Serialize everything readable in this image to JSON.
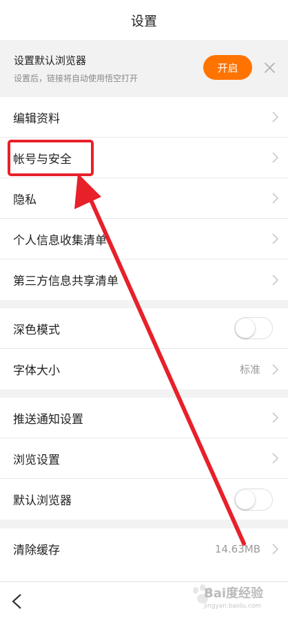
{
  "header": {
    "title": "设置"
  },
  "banner": {
    "title": "设置默认浏览器",
    "subtitle": "设置后，链接将自动使用悟空打开",
    "button_label": "开启",
    "close_icon": "close-icon"
  },
  "section_1": {
    "rows": [
      {
        "label": "编辑资料"
      },
      {
        "label": "帐号与安全"
      },
      {
        "label": "隐私"
      },
      {
        "label": "个人信息收集清单"
      },
      {
        "label": "第三方信息共享清单"
      }
    ]
  },
  "section_2": {
    "rows": [
      {
        "label": "深色模式",
        "toggle_on": false
      },
      {
        "label": "字体大小",
        "value": "标准"
      }
    ]
  },
  "section_3": {
    "rows": [
      {
        "label": "推送通知设置"
      },
      {
        "label": "浏览设置"
      },
      {
        "label": "默认浏览器",
        "toggle_on": false
      }
    ]
  },
  "section_4": {
    "rows": [
      {
        "label": "清除缓存",
        "value": "14.63MB"
      }
    ]
  },
  "watermark": {
    "brand": "Bai度经验",
    "url": "jingyan.baidu.com"
  },
  "colors": {
    "accent": "#ff7300",
    "annotation": "#e8202a"
  }
}
